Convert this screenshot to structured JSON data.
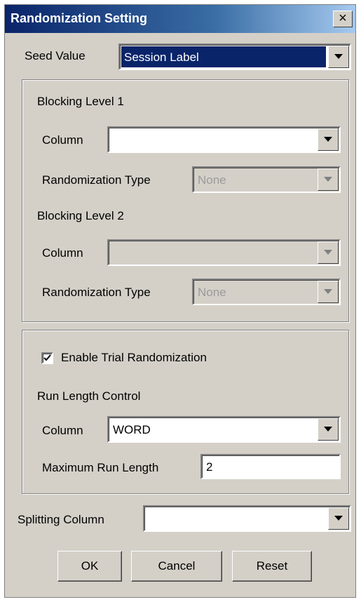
{
  "window": {
    "title": "Randomization Setting",
    "close_label": "×",
    "close_icon": "close-icon"
  },
  "seed": {
    "label": "Seed Value",
    "value": "Session Label"
  },
  "blocking1": {
    "heading": "Blocking Level 1",
    "column_label": "Column",
    "column_value": "",
    "type_label": "Randomization Type",
    "type_value": "None"
  },
  "blocking2": {
    "heading": "Blocking Level 2",
    "column_label": "Column",
    "column_value": "",
    "type_label": "Randomization Type",
    "type_value": "None"
  },
  "trial": {
    "enable_label": "Enable Trial Randomization",
    "enable_checked": true,
    "run_length_heading": "Run Length Control",
    "column_label": "Column",
    "column_value": "WORD",
    "max_run_label": "Maximum Run Length",
    "max_run_value": "2"
  },
  "splitting": {
    "label": "Splitting Column",
    "value": ""
  },
  "buttons": {
    "ok": "OK",
    "cancel": "Cancel",
    "reset": "Reset"
  },
  "colors": {
    "title_bar": "#0a246a",
    "dialog_face": "#d4d0c8",
    "selection": "#0a246a"
  },
  "icons": {
    "dropdown": "chevron-down-icon",
    "check": "check-icon"
  }
}
